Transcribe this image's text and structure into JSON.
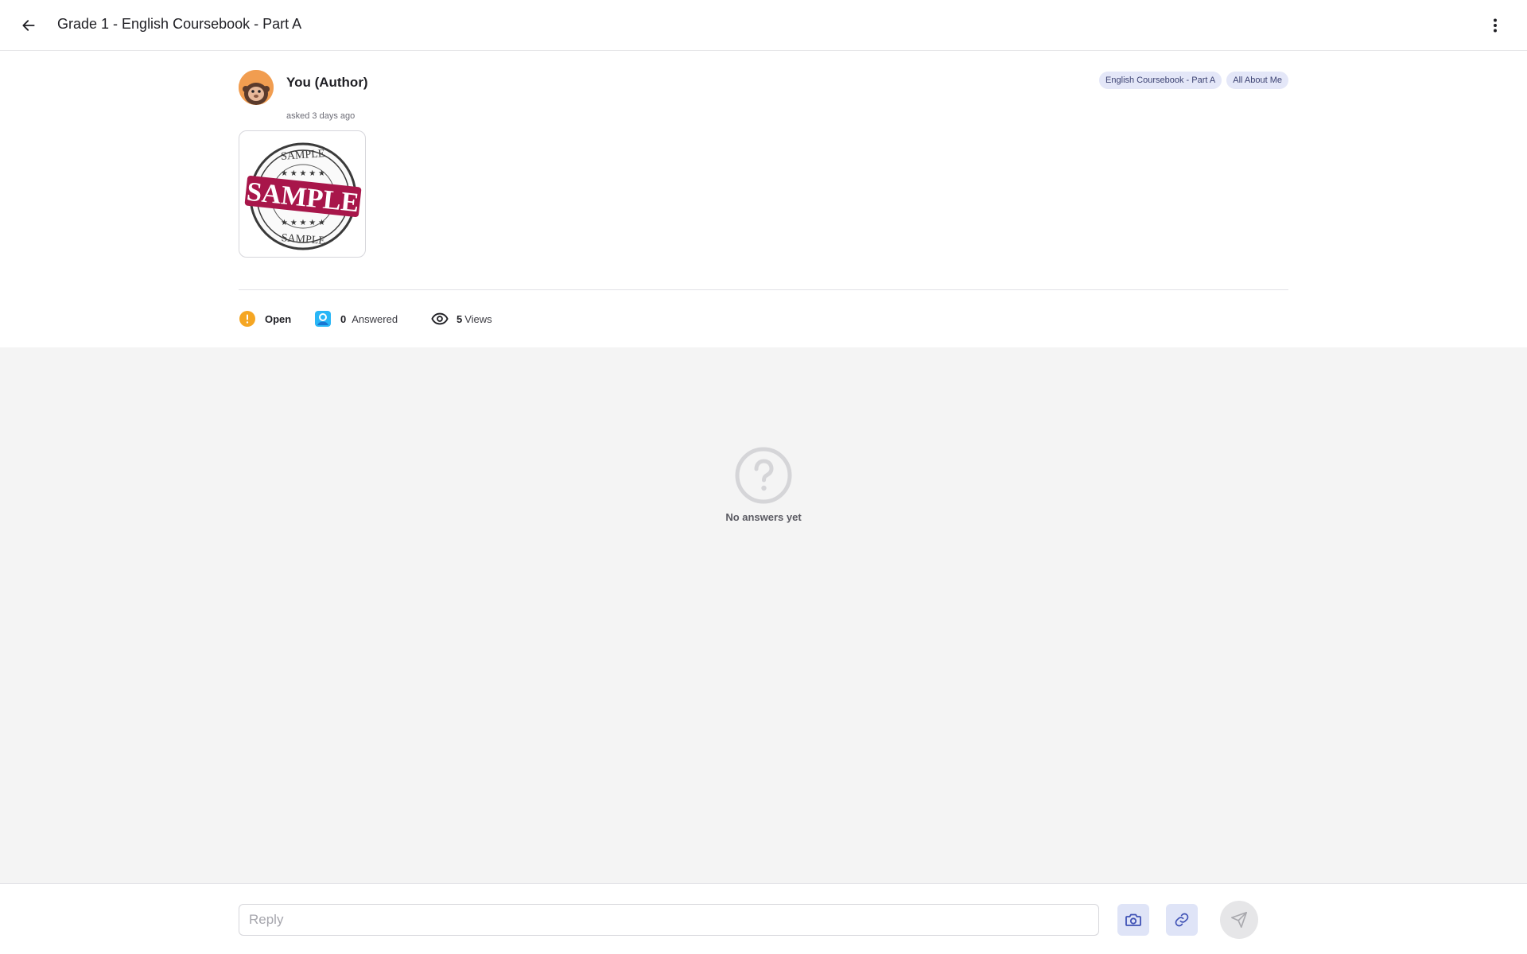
{
  "header": {
    "title": "Grade 1 - English Coursebook - Part A",
    "back_icon": "arrow-left-icon",
    "menu_icon": "more-vertical-icon"
  },
  "question": {
    "author": "You (Author)",
    "asked": "asked 3 days ago",
    "tags": [
      "English Coursebook - Part A",
      "All About Me"
    ],
    "attachment_text": [
      "SAMPLE",
      "SAMPLE",
      "SAMPLE"
    ]
  },
  "stats": {
    "status_label": "Open",
    "answered_count": "0",
    "answered_label": "Answered",
    "views_count": "5",
    "views_label": "Views"
  },
  "answers": {
    "empty_text": "No answers yet"
  },
  "reply": {
    "placeholder": "Reply",
    "value": ""
  },
  "colors": {
    "accent": "#3f51b5",
    "open_status": "#f5a623",
    "answered_status": "#29b6f6",
    "tag_bg": "#e4e7f8",
    "stamp": "#a8164a"
  }
}
